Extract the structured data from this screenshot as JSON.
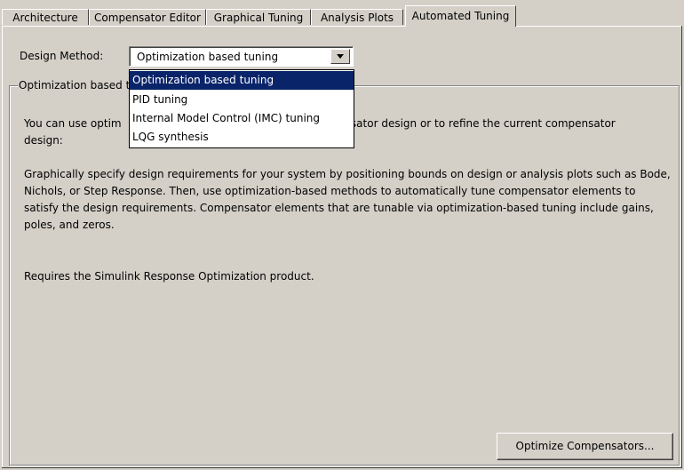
{
  "tabs": [
    {
      "label": "Architecture",
      "active": false
    },
    {
      "label": "Compensator Editor",
      "active": false
    },
    {
      "label": "Graphical Tuning",
      "active": false
    },
    {
      "label": "Analysis Plots",
      "active": false
    },
    {
      "label": "Automated Tuning",
      "active": true
    }
  ],
  "design_method": {
    "label": "Design Method:",
    "value": "Optimization based tuning",
    "options": [
      "Optimization based tuning",
      "PID tuning",
      "Internal Model Control (IMC) tuning",
      "LQG synthesis"
    ],
    "selected_index": 0
  },
  "group": {
    "title": "Optimization based t",
    "para1_line1": "You can use optim",
    "para1_line1_end": "mpensator design or to refine the current compensator",
    "para1_line2": "design:",
    "para2": "Graphically specify design requirements for your system by positioning bounds on design or analysis plots such as Bode, Nichols, or Step Response. Then, use optimization-based methods to automatically tune compensator elements to satisfy the design requirements. Compensator elements that are tunable via optimization-based tuning include gains, poles, and zeros.",
    "para3": "Requires the Simulink Response Optimization product."
  },
  "buttons": {
    "optimize": "Optimize Compensators..."
  },
  "colors": {
    "background": "#d4d0c8",
    "selection": "#0a246a"
  }
}
